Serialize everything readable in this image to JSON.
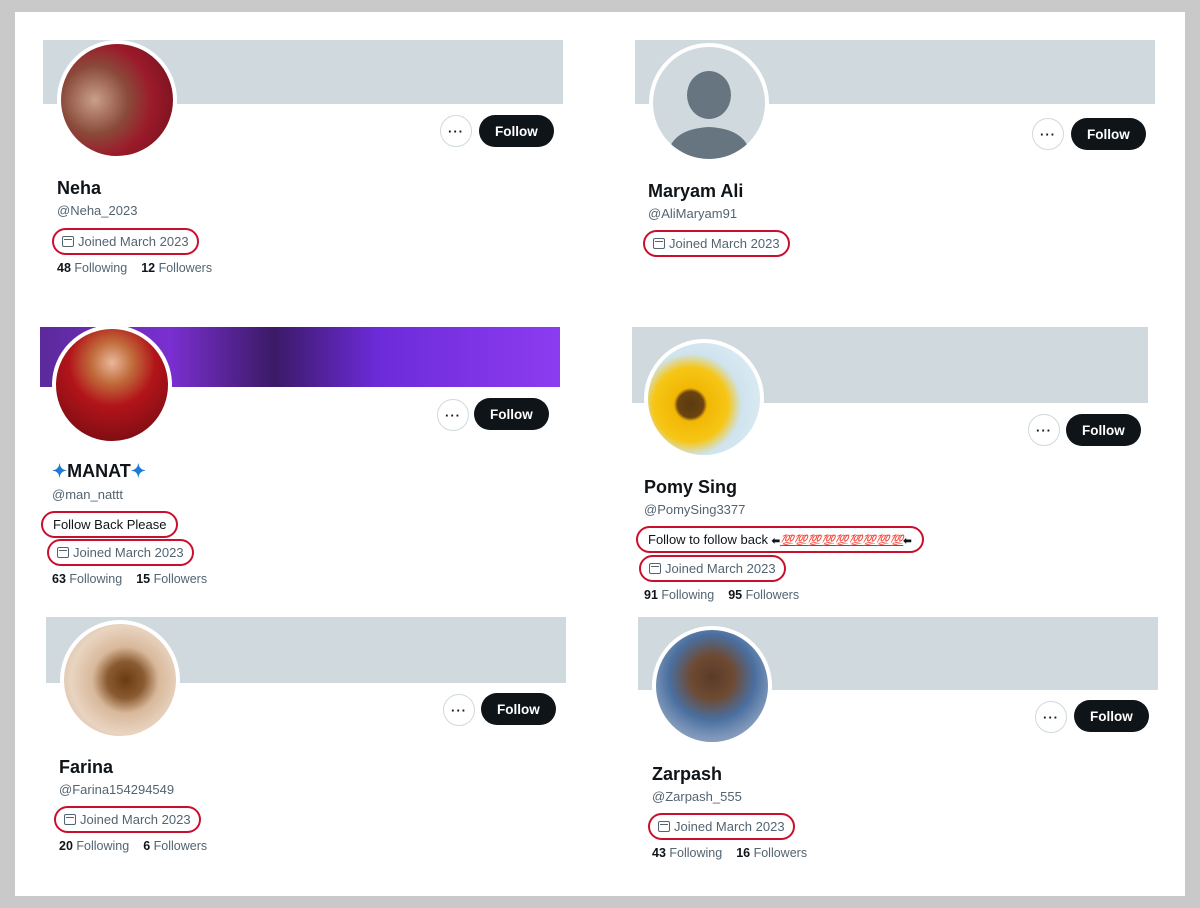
{
  "ui": {
    "follow_label": "Follow",
    "more_label": "···",
    "joined": "Joined March 2023"
  },
  "profiles": [
    {
      "name": "Neha",
      "handle": "@Neha_2023",
      "following": "48",
      "followers": "12",
      "following_label": "Following",
      "followers_label": "Followers"
    },
    {
      "name": "Maryam Ali",
      "handle": "@AliMaryam91"
    },
    {
      "name_text": "MANAT",
      "handle": "@man_nattt",
      "bio": "Follow Back Please",
      "following": "63",
      "followers": "15",
      "following_label": "Following",
      "followers_label": "Followers"
    },
    {
      "name": "Pomy Sing",
      "handle": "@PomySing3377",
      "bio": "Follow to follow back",
      "following": "91",
      "followers": "95",
      "following_label": "Following",
      "followers_label": "Followers"
    },
    {
      "name": "Farina",
      "handle": "@Farina154294549",
      "following": "20",
      "followers": "6",
      "following_label": "Following",
      "followers_label": "Followers"
    },
    {
      "name": "Zarpash",
      "handle": "@Zarpash_555",
      "following": "43",
      "followers": "16",
      "following_label": "Following",
      "followers_label": "Followers"
    }
  ],
  "colors": {
    "highlight": "#c8102e",
    "banner": "#cfd9de",
    "button": "#0f1419"
  }
}
